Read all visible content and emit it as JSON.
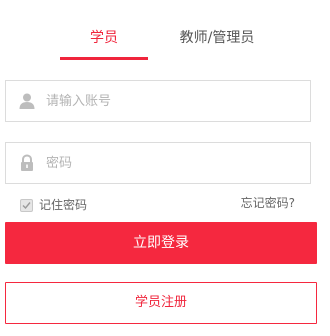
{
  "tabs": {
    "student_label": "学员",
    "teacher_label": "教师/管理员",
    "active": "student"
  },
  "form": {
    "account_placeholder": "请输入账号",
    "account_value": "",
    "password_placeholder": "密码",
    "password_value": "",
    "remember_label": "记住密码",
    "remember_checked": true,
    "forgot_label": "忘记密码?"
  },
  "buttons": {
    "login_label": "立即登录",
    "register_label": "学员注册"
  },
  "colors": {
    "accent": "#f5283f",
    "icon_gray": "#bdbdbd",
    "border": "#dcdcdc"
  },
  "icons": {
    "account": "user-icon",
    "password": "lock-icon",
    "remember": "check-icon"
  }
}
